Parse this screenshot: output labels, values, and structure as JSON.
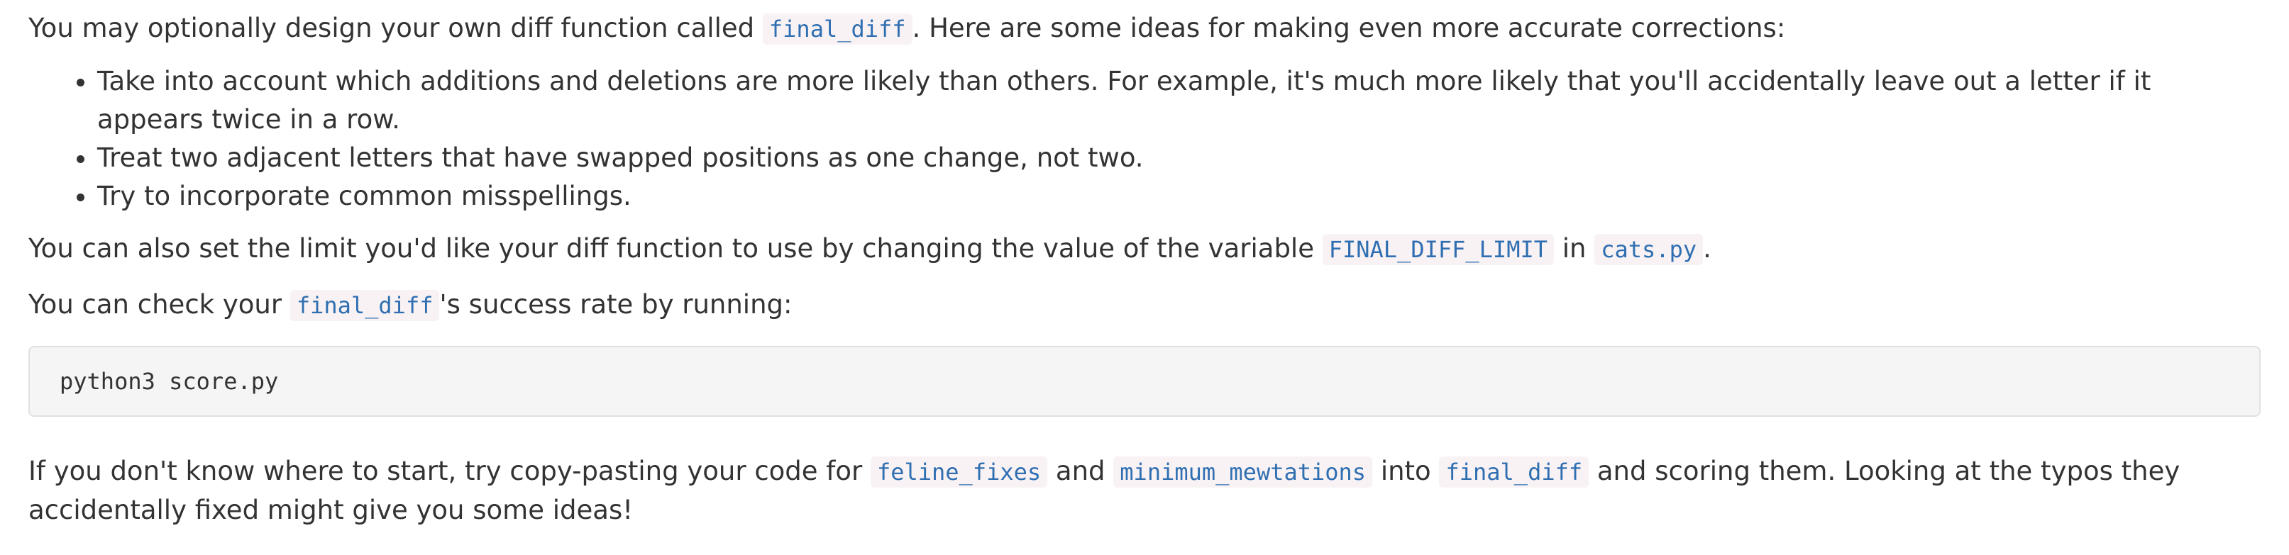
{
  "intro": {
    "before": "You may optionally design your own diff function called ",
    "code": "final_diff",
    "after": ". Here are some ideas for making even more accurate corrections:"
  },
  "ideas": [
    "Take into account which additions and deletions are more likely than others. For example, it's much more likely that you'll accidentally leave out a letter if it appears twice in a row.",
    "Treat two adjacent letters that have swapped positions as one change, not two.",
    "Try to incorporate common misspellings."
  ],
  "limit": {
    "before": "You can also set the limit you'd like your diff function to use by changing the value of the variable ",
    "code1": "FINAL_DIFF_LIMIT",
    "middle": " in ",
    "code2": "cats.py",
    "after": "."
  },
  "check": {
    "before": "You can check your ",
    "code": "final_diff",
    "after": "'s success rate by running:"
  },
  "command": "python3 score.py",
  "tip": {
    "before": "If you don't know where to start, try copy-pasting your code for ",
    "code1": "feline_fixes",
    "and": " and ",
    "code2": "minimum_mewtations",
    "into": " into ",
    "code3": "final_diff",
    "after": " and scoring them. Looking at the typos they accidentally fixed might give you some ideas!"
  }
}
